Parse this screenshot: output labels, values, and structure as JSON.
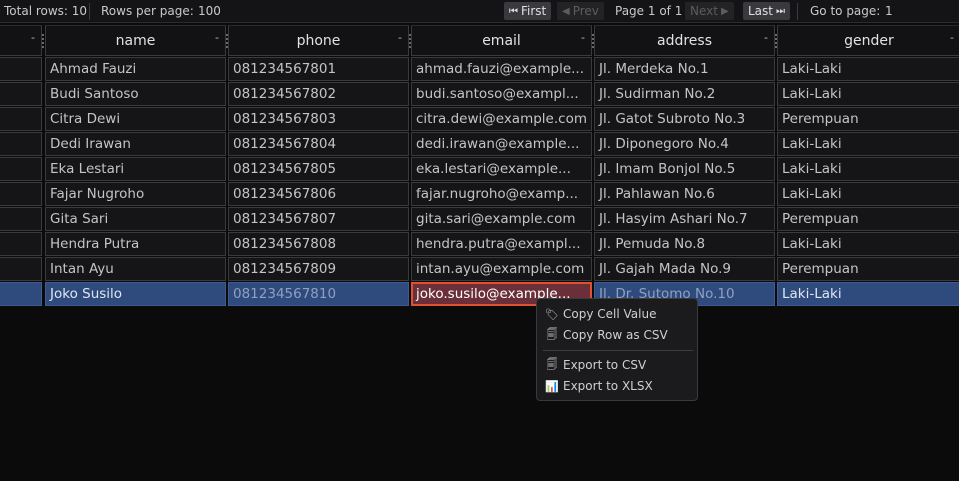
{
  "toolbar": {
    "total_rows_label": "Total rows: 10",
    "rows_per_page_label": "Rows per page:",
    "rows_per_page_value": "100",
    "first_label": "First",
    "first_icon": "⏮",
    "prev_label": "Prev",
    "prev_icon": "◀",
    "page_label": "Page 1 of 1",
    "next_label": "Next",
    "next_icon": "▶",
    "last_label": "Last",
    "last_icon": "⏭",
    "goto_label": "Go to page:",
    "goto_value": "1"
  },
  "table": {
    "index_header": "",
    "menu_glyph": "-",
    "columns": [
      "name",
      "phone",
      "email",
      "address",
      "gender"
    ],
    "rows": [
      [
        "Ahmad Fauzi",
        "081234567801",
        "ahmad.fauzi@example...",
        "Jl. Merdeka No.1",
        "Laki-Laki"
      ],
      [
        "Budi Santoso",
        "081234567802",
        "budi.santoso@exampl...",
        "Jl. Sudirman No.2",
        "Laki-Laki"
      ],
      [
        "Citra Dewi",
        "081234567803",
        "citra.dewi@example.com",
        "Jl. Gatot Subroto No.3",
        "Perempuan"
      ],
      [
        "Dedi Irawan",
        "081234567804",
        "dedi.irawan@example...",
        "Jl. Diponegoro No.4",
        "Laki-Laki"
      ],
      [
        "Eka Lestari",
        "081234567805",
        "eka.lestari@example...",
        "Jl. Imam Bonjol No.5",
        "Laki-Laki"
      ],
      [
        "Fajar Nugroho",
        "081234567806",
        "fajar.nugroho@examp...",
        "Jl. Pahlawan No.6",
        "Laki-Laki"
      ],
      [
        "Gita Sari",
        "081234567807",
        "gita.sari@example.com",
        "Jl. Hasyim Ashari No.7",
        "Perempuan"
      ],
      [
        "Hendra Putra",
        "081234567808",
        "hendra.putra@exampl...",
        "Jl. Pemuda No.8",
        "Laki-Laki"
      ],
      [
        "Intan Ayu",
        "081234567809",
        "intan.ayu@example.com",
        "Jl. Gajah Mada No.9",
        "Perempuan"
      ],
      [
        "Joko Susilo",
        "081234567810",
        "joko.susilo@example...",
        "Jl. Dr. Sutomo No.10",
        "Laki-Laki"
      ]
    ]
  },
  "context_menu": {
    "items": [
      {
        "label": "Copy Cell Value",
        "icon": "tag-icon",
        "glyph": "🏷"
      },
      {
        "label": "Copy Row as CSV",
        "icon": "copy-icon",
        "glyph": "🗐"
      },
      {
        "label": "Export to CSV",
        "icon": "document-icon",
        "glyph": "🗐"
      },
      {
        "label": "Export to XLSX",
        "icon": "bar-chart-icon",
        "glyph": "📊"
      }
    ]
  },
  "colors": {
    "background": "#0b0b0c",
    "selection": "#2f4a7c",
    "focus_border": "#e0522f",
    "focus_fill": "#6a2f38"
  }
}
